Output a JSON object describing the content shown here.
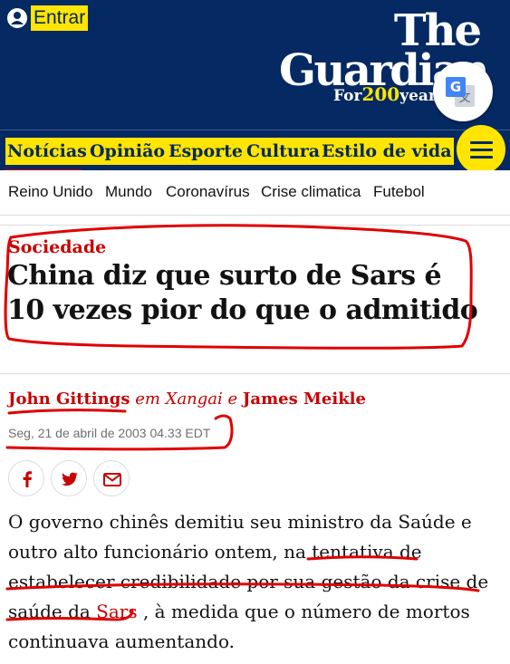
{
  "header": {
    "signin_label": "Entrar",
    "logo_line1": "The",
    "logo_line2": "Guardian",
    "logo_for": "For",
    "logo_200": "200",
    "logo_years": "years",
    "nav": [
      {
        "label": "Notícias"
      },
      {
        "label": "Opinião"
      },
      {
        "label": "Esporte"
      },
      {
        "label": "Cultura"
      },
      {
        "label": "Estilo de vida"
      }
    ],
    "subnav": [
      "Reino Unido",
      "Mundo",
      "Coronavírus",
      "Crise climatica",
      "Futebol"
    ]
  },
  "article": {
    "kicker": "Sociedade",
    "headline": "China diz que surto de Sars é 10 vezes pior do que o admitido",
    "byline_author1": "John Gittings",
    "byline_location": "em Xangai",
    "byline_and": "e",
    "byline_author2": "James Meikle",
    "date": "Seg, 21 de abril de 2003 04.33 EDT",
    "body_part1": "O governo chinês demitiu seu ministro da Saúde e outro alto funcionário ontem, na tentativa de estabelecer credibilidade por sua gestão da crise de saúde da ",
    "body_link": "Sars",
    "body_part2": " , à medida que o número de mortos continuava aumentando."
  },
  "share": [
    {
      "icon": "facebook-icon"
    },
    {
      "icon": "twitter-icon"
    },
    {
      "icon": "email-icon"
    }
  ],
  "colors": {
    "brand_blue": "#052962",
    "highlight_yellow": "#ffe500",
    "news_red": "#c70000",
    "annotation_red": "#e00000"
  }
}
